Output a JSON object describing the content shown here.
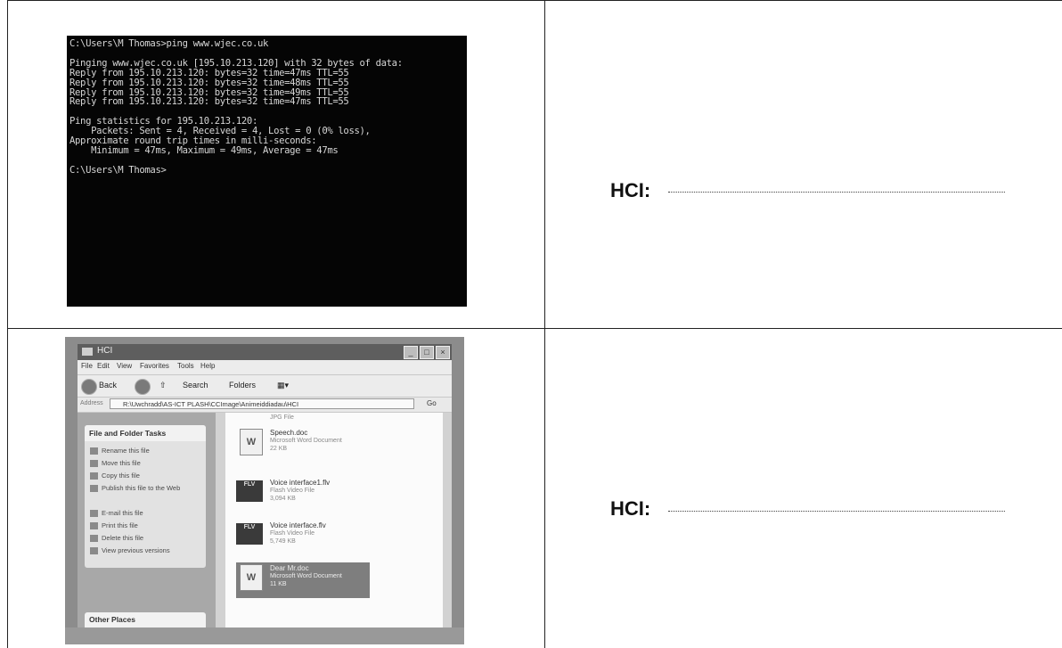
{
  "rows": [
    {
      "label": "HCI:"
    },
    {
      "label": "HCI:"
    }
  ],
  "console": {
    "lines": [
      "C:\\Users\\M Thomas>ping www.wjec.co.uk",
      "",
      "Pinging www.wjec.co.uk [195.10.213.120] with 32 bytes of data:",
      "Reply from 195.10.213.120: bytes=32 time=47ms TTL=55",
      "Reply from 195.10.213.120: bytes=32 time=48ms TTL=55",
      "Reply from 195.10.213.120: bytes=32 time=49ms TTL=55",
      "Reply from 195.10.213.120: bytes=32 time=47ms TTL=55",
      "",
      "Ping statistics for 195.10.213.120:",
      "    Packets: Sent = 4, Received = 4, Lost = 0 (0% loss),",
      "Approximate round trip times in milli-seconds:",
      "    Minimum = 47ms, Maximum = 49ms, Average = 47ms",
      "",
      "C:\\Users\\M Thomas>"
    ]
  },
  "explorer": {
    "title": "HCI",
    "menu": [
      "File",
      "Edit",
      "View",
      "Favorites",
      "Tools",
      "Help"
    ],
    "toolbar": {
      "back": "Back",
      "search": "Search",
      "folders": "Folders"
    },
    "address_label": "Address",
    "address": "R:\\Uwchradd\\AS-ICT PLASH\\CCImage\\Animeiddiadau\\HCI",
    "go": "Go",
    "tasks_title": "File and Folder Tasks",
    "tasks": [
      "Rename this file",
      "Move this file",
      "Copy this file",
      "Publish this file to the Web",
      "E-mail this file",
      "Print this file",
      "Delete this file",
      "View previous versions"
    ],
    "other_places": "Other Places",
    "top_partial": "JPG File",
    "files": [
      {
        "name": "Speech.doc",
        "type": "Microsoft Word Document",
        "size": "22 KB",
        "icon": "W"
      },
      {
        "name": "Voice interface1.flv",
        "type": "Flash Video File",
        "size": "3,094 KB",
        "icon": "FLV"
      },
      {
        "name": "Voice interface.flv",
        "type": "Flash Video File",
        "size": "5,749 KB",
        "icon": "FLV"
      },
      {
        "name": "Dear Mr.doc",
        "type": "Microsoft Word Document",
        "size": "11 KB",
        "icon": "W"
      }
    ]
  }
}
